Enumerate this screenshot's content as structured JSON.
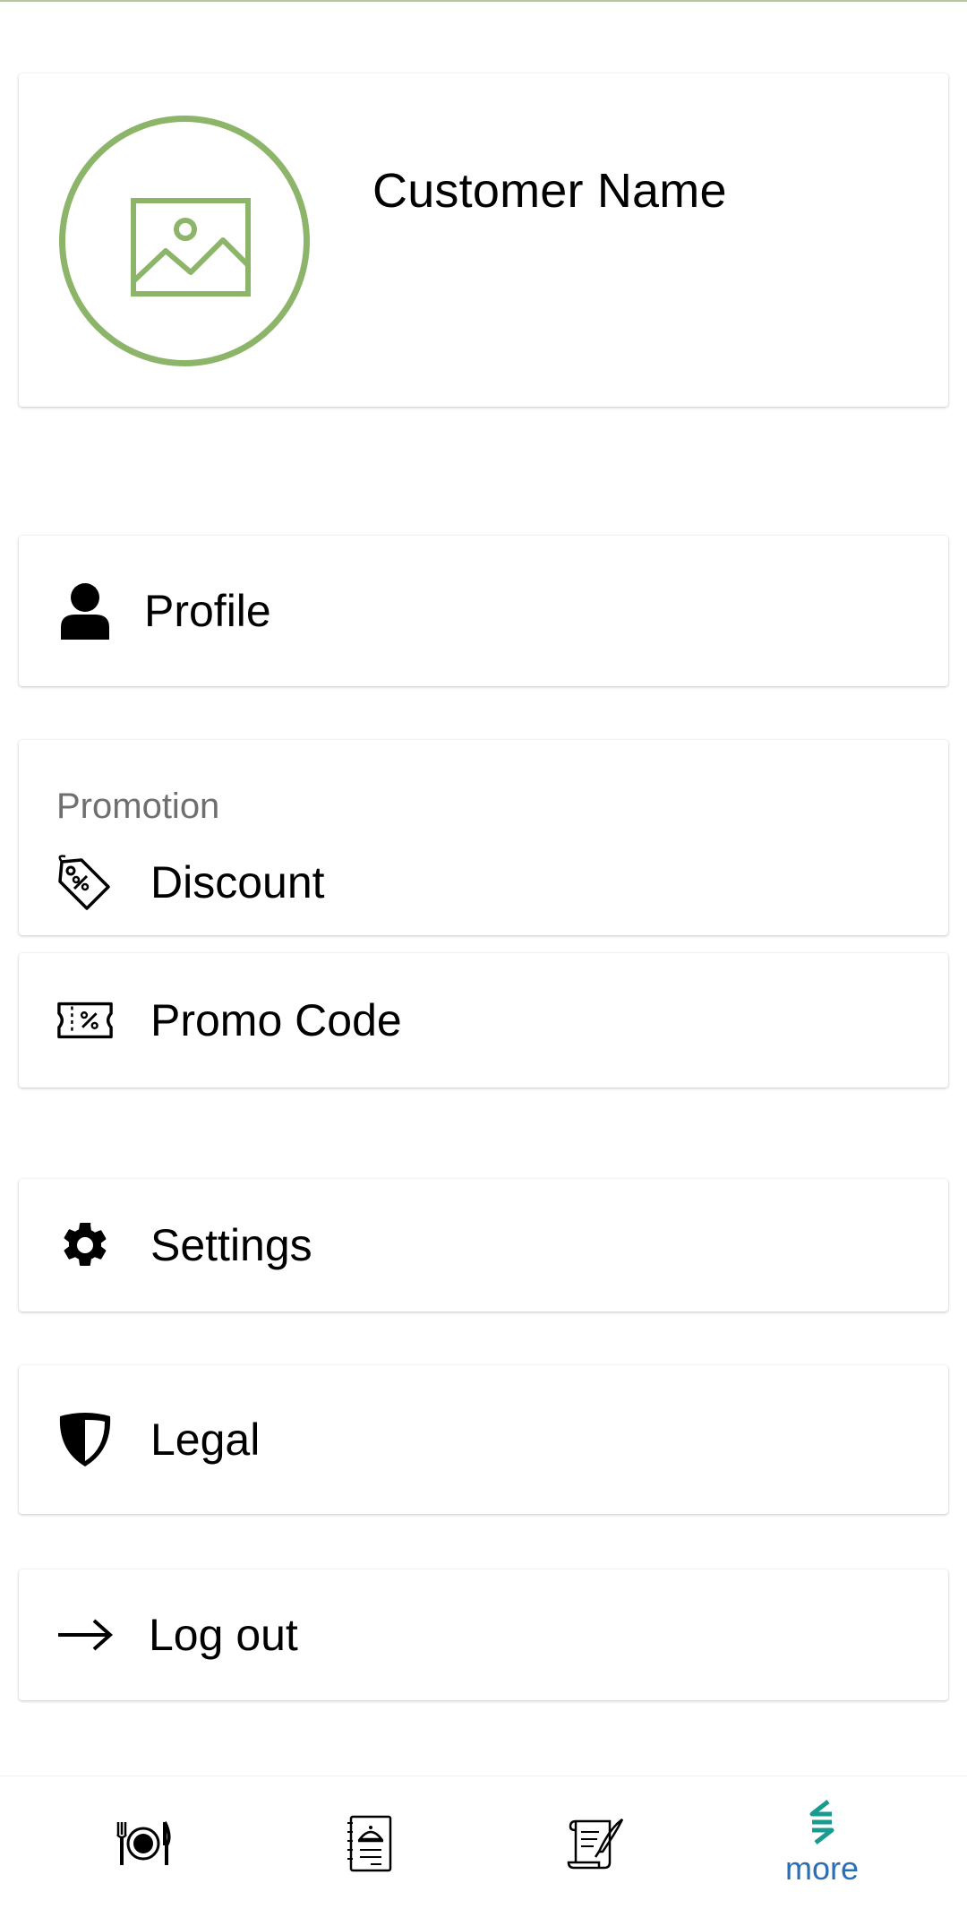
{
  "profile": {
    "customer_name": "Customer Name",
    "avatar_icon": "image-placeholder-icon"
  },
  "menu": {
    "profile_label": "Profile",
    "promotion_header": "Promotion",
    "discount_label": "Discount",
    "promo_code_label": "Promo Code",
    "settings_label": "Settings",
    "legal_label": "Legal",
    "logout_label": "Log out"
  },
  "bottom_nav": {
    "items": [
      {
        "icon": "restaurant-icon",
        "label": ""
      },
      {
        "icon": "menu-book-icon",
        "label": ""
      },
      {
        "icon": "scroll-quill-icon",
        "label": ""
      },
      {
        "icon": "more-icon",
        "label": "more"
      }
    ]
  },
  "colors": {
    "accent_green": "#8db56a",
    "nav_active": "#2a6fb5",
    "nav_icon_teal": "#1a9b8f"
  }
}
